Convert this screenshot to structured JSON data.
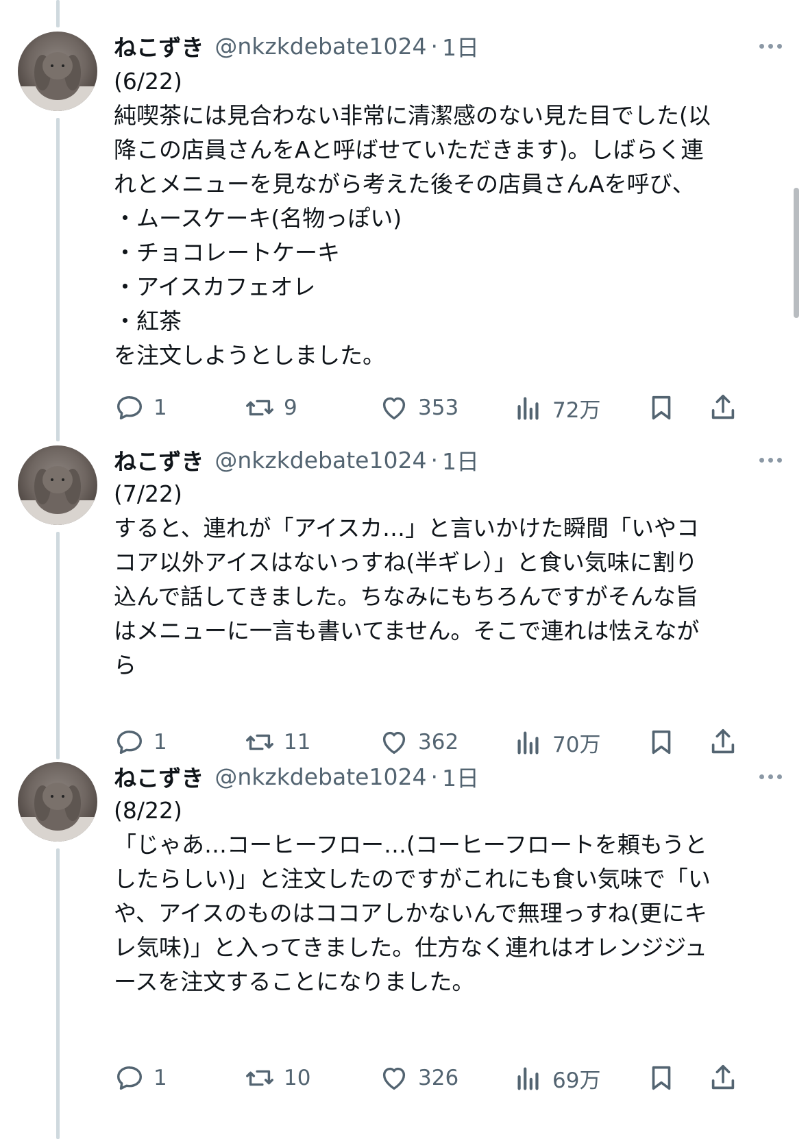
{
  "tweets": [
    {
      "author": {
        "name": "ねこずき",
        "handle": "@nkzkdebate1024",
        "time": "1日"
      },
      "lines": [
        "(6/22)",
        "純喫茶には見合わない非常に清潔感のない見た目でした(以",
        "降この店員さんをAと呼ばせていただきます)。しばらく連",
        "れとメニューを見ながら考えた後その店員さんAを呼び、",
        "・ムースケーキ(名物っぽい)",
        "・チョコレートケーキ",
        "・アイスカフェオレ",
        "・紅茶",
        "を注文しようとしました。"
      ],
      "stats": {
        "replies": "1",
        "retweets": "9",
        "likes": "353",
        "views": "72万"
      }
    },
    {
      "author": {
        "name": "ねこずき",
        "handle": "@nkzkdebate1024",
        "time": "1日"
      },
      "lines": [
        "(7/22)",
        "すると、連れが「アイスカ…」と言いかけた瞬間「いやコ",
        "コア以外アイスはないっすね(半ギレ）」と食い気味に割り",
        "込んで話してきました。ちなみにもちろんですがそんな旨",
        "はメニューに一言も書いてません。そこで連れは怯えなが",
        "ら"
      ],
      "stats": {
        "replies": "1",
        "retweets": "11",
        "likes": "362",
        "views": "70万"
      }
    },
    {
      "author": {
        "name": "ねこずき",
        "handle": "@nkzkdebate1024",
        "time": "1日"
      },
      "lines": [
        "(8/22)",
        "「じゃあ…コーヒーフロー…(コーヒーフロートを頼もうと",
        "したらしい)」と注文したのですがこれにも食い気味で「い",
        "や、アイスのものはココアしかないんで無理っすね(更にキ",
        "レ気味)」と入ってきました。仕方なく連れはオレンジジュ",
        "ースを注文することになりました。"
      ],
      "stats": {
        "replies": "1",
        "retweets": "10",
        "likes": "326",
        "views": "69万"
      }
    }
  ],
  "icons": {
    "more": "more-dots-icon",
    "reply": "reply-bubble-icon",
    "retweet": "retweet-icon",
    "like": "heart-icon",
    "views": "views-chart-icon",
    "bookmark": "bookmark-icon",
    "share": "share-icon"
  },
  "colors": {
    "text": "#0f1419",
    "secondary": "#536471",
    "thread_line": "#cfd9de"
  }
}
